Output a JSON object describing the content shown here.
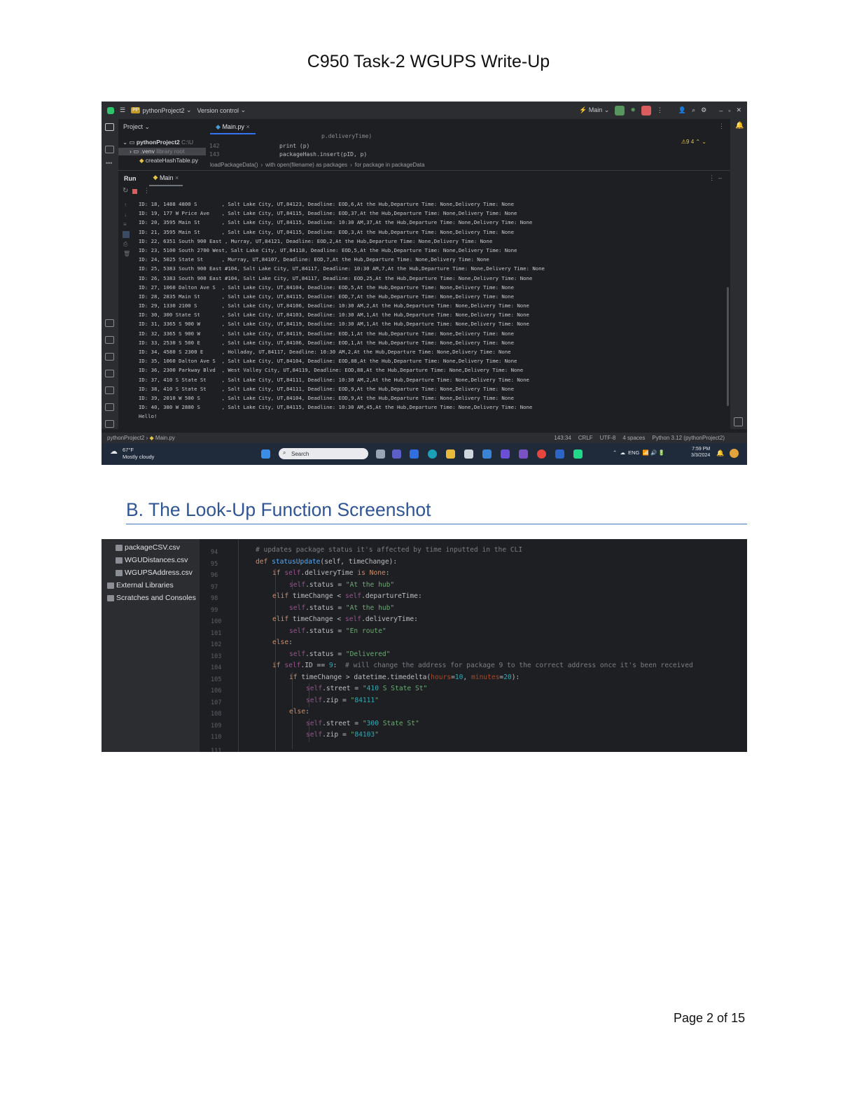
{
  "document": {
    "title": "C950 Task-2 WGUPS Write-Up",
    "section_heading": "B. The Look-Up Function Screenshot",
    "page_number": "Page 2 of 15"
  },
  "ide1": {
    "project_name": "pythonProject2",
    "version_control": "Version control",
    "run_config": "Main",
    "project_label": "Project",
    "editor_tab": "Main.py",
    "tree": [
      "pythonProject2",
      ".venv",
      "createHashTable.py"
    ],
    "tree_suffix": [
      "C:\\U",
      "library root",
      ""
    ],
    "code_lines": [
      {
        "ln": "142",
        "text": "print (p)"
      },
      {
        "ln": "143",
        "text": "packageHash.insert(pID, p)"
      }
    ],
    "code_partial": "p.deliveryTime)",
    "breadcrumbs": [
      "loadPackageData()",
      "with open(filename) as packages",
      "for package in packageData"
    ],
    "inspections": "9  4",
    "run_label": "Run",
    "run_tab": "Main",
    "console_lines": [
      "ID: 18, 1488 4800 S        , Salt Lake City, UT,84123, Deadline: EOD,6,At the Hub,Departure Time: None,Delivery Time: None",
      "ID: 19, 177 W Price Ave    , Salt Lake City, UT,84115, Deadline: EOD,37,At the Hub,Departure Time: None,Delivery Time: None",
      "ID: 20, 3595 Main St       , Salt Lake City, UT,84115, Deadline: 10:30 AM,37,At the Hub,Departure Time: None,Delivery Time: None",
      "ID: 21, 3595 Main St       , Salt Lake City, UT,84115, Deadline: EOD,3,At the Hub,Departure Time: None,Delivery Time: None",
      "ID: 22, 6351 South 900 East , Murray, UT,84121, Deadline: EOD,2,At the Hub,Departure Time: None,Delivery Time: None",
      "ID: 23, 5100 South 2700 West, Salt Lake City, UT,84118, Deadline: EOD,5,At the Hub,Departure Time: None,Delivery Time: None",
      "ID: 24, 5025 State St      , Murray, UT,84107, Deadline: EOD,7,At the Hub,Departure Time: None,Delivery Time: None",
      "ID: 25, 5383 South 900 East #104, Salt Lake City, UT,84117, Deadline: 10:30 AM,7,At the Hub,Departure Time: None,Delivery Time: None",
      "ID: 26, 5383 South 900 East #104, Salt Lake City, UT,84117, Deadline: EOD,25,At the Hub,Departure Time: None,Delivery Time: None",
      "ID: 27, 1060 Dalton Ave S  , Salt Lake City, UT,84104, Deadline: EOD,5,At the Hub,Departure Time: None,Delivery Time: None",
      "ID: 28, 2835 Main St       , Salt Lake City, UT,84115, Deadline: EOD,7,At the Hub,Departure Time: None,Delivery Time: None",
      "ID: 29, 1330 2100 S        , Salt Lake City, UT,84106, Deadline: 10:30 AM,2,At the Hub,Departure Time: None,Delivery Time: None",
      "ID: 30, 300 State St       , Salt Lake City, UT,84103, Deadline: 10:30 AM,1,At the Hub,Departure Time: None,Delivery Time: None",
      "ID: 31, 3365 S 900 W       , Salt Lake City, UT,84119, Deadline: 10:30 AM,1,At the Hub,Departure Time: None,Delivery Time: None",
      "ID: 32, 3365 S 900 W       , Salt Lake City, UT,84119, Deadline: EOD,1,At the Hub,Departure Time: None,Delivery Time: None",
      "ID: 33, 2530 S 500 E       , Salt Lake City, UT,84106, Deadline: EOD,1,At the Hub,Departure Time: None,Delivery Time: None",
      "ID: 34, 4580 S 2300 E      , Holladay, UT,84117, Deadline: 10:30 AM,2,At the Hub,Departure Time: None,Delivery Time: None",
      "ID: 35, 1060 Dalton Ave S  , Salt Lake City, UT,84104, Deadline: EOD,88,At the Hub,Departure Time: None,Delivery Time: None",
      "ID: 36, 2300 Parkway Blvd  , West Valley City, UT,84119, Deadline: EOD,88,At the Hub,Departure Time: None,Delivery Time: None",
      "ID: 37, 410 S State St     , Salt Lake City, UT,84111, Deadline: 10:30 AM,2,At the Hub,Departure Time: None,Delivery Time: None",
      "ID: 38, 410 S State St     , Salt Lake City, UT,84111, Deadline: EOD,9,At the Hub,Departure Time: None,Delivery Time: None",
      "ID: 39, 2010 W 500 S       , Salt Lake City, UT,84104, Deadline: EOD,9,At the Hub,Departure Time: None,Delivery Time: None",
      "ID: 40, 380 W 2880 S       , Salt Lake City, UT,84115, Deadline: 10:30 AM,45,At the Hub,Departure Time: None,Delivery Time: None",
      "Hello!"
    ],
    "status_path": [
      "pythonProject2",
      "Main.py"
    ],
    "status_right": [
      "143:34",
      "CRLF",
      "UTF-8",
      "4 spaces",
      "Python 3.12 (pythonProject2)"
    ],
    "weather_temp": "67°F",
    "weather_desc": "Mostly cloudy",
    "search_placeholder": "Search",
    "tray_lang": "ENG",
    "clock_time": "7:59 PM",
    "clock_date": "3/3/2024",
    "colors": {
      "accent": "#3574f0",
      "run_green": "#57965c",
      "stop_red": "#db5c5c"
    }
  },
  "ide2": {
    "files": [
      "packageCSV.csv",
      "WGUDistances.csv",
      "WGUPSAddress.csv",
      "External Libraries",
      "Scratches and Consoles"
    ],
    "line_numbers": [
      "94",
      "95",
      "96",
      "97",
      "98",
      "99",
      "100",
      "101",
      "102",
      "103",
      "104",
      "105",
      "106",
      "107",
      "108",
      "109",
      "110",
      "111"
    ],
    "comment_94": "# updates package status it's affected by time inputted in the CLI",
    "def_kw": "def",
    "func_name": "statusUpdate",
    "func_params": "(self, timeChange):",
    "l96": "if self.deliveryTime is None:",
    "l97": "self.status = \"At the hub\"",
    "l98": "elif timeChange < self.departureTime:",
    "l99": "self.status = \"At the hub\"",
    "l100": "elif timeChange < self.deliveryTime:",
    "l101": "self.status = \"En route\"",
    "l102": "else:",
    "l103": "self.status = \"Delivered\"",
    "l104_code": "if self.ID == 9:",
    "l104_comment": "# will change the address for package 9 to the correct address once it's been received",
    "l105": "if timeChange > datetime.timedelta(hours=10, minutes=20):",
    "l106": "self.street = \"410 S State St\"",
    "l107": "self.zip = \"84111\"",
    "l108": "else:",
    "l109": "self.street = \"300 State St\"",
    "l110": "self.zip = \"84103\""
  }
}
